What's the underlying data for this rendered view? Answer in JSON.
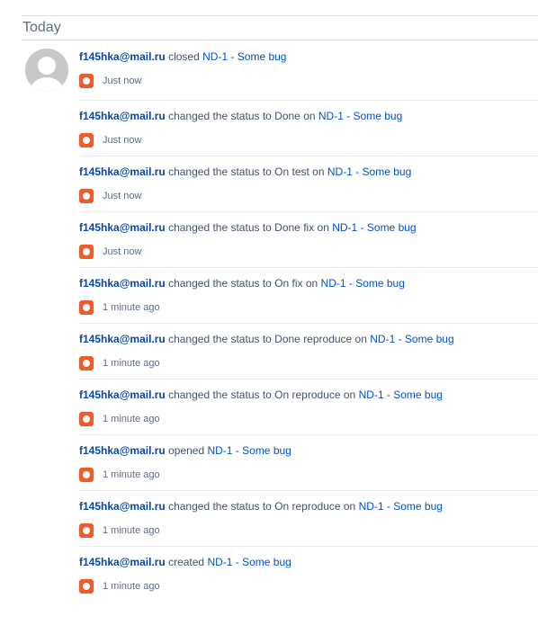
{
  "group": {
    "title": "Today"
  },
  "entries": [
    {
      "user": "f145hka@mail.ru",
      "action": " closed ",
      "issue": "ND-1 - Some bug",
      "time": "Just now"
    },
    {
      "user": "f145hka@mail.ru",
      "action": " changed the status to Done on ",
      "issue": "ND-1 - Some bug",
      "time": "Just now"
    },
    {
      "user": "f145hka@mail.ru",
      "action": " changed the status to On test on ",
      "issue": "ND-1 - Some bug",
      "time": "Just now"
    },
    {
      "user": "f145hka@mail.ru",
      "action": " changed the status to Done fix on ",
      "issue": "ND-1 - Some bug",
      "time": "Just now"
    },
    {
      "user": "f145hka@mail.ru",
      "action": " changed the status to On fix on ",
      "issue": "ND-1 - Some bug",
      "time": "1 minute ago"
    },
    {
      "user": "f145hka@mail.ru",
      "action": " changed the status to Done reproduce on ",
      "issue": "ND-1 - Some bug",
      "time": "1 minute ago"
    },
    {
      "user": "f145hka@mail.ru",
      "action": " changed the status to On reproduce on ",
      "issue": "ND-1 - Some bug",
      "time": "1 minute ago"
    },
    {
      "user": "f145hka@mail.ru",
      "action": " opened ",
      "issue": "ND-1 - Some bug",
      "time": "1 minute ago"
    },
    {
      "user": "f145hka@mail.ru",
      "action": " changed the status to On reproduce on ",
      "issue": "ND-1 - Some bug",
      "time": "1 minute ago"
    },
    {
      "user": "f145hka@mail.ru",
      "action": " created ",
      "issue": "ND-1 - Some bug",
      "time": "1 minute ago"
    }
  ],
  "icons": {
    "avatar": "default-user-avatar",
    "app": "app-circle-icon"
  },
  "colors": {
    "user_link": "#0747a6",
    "issue_link": "#0052cc",
    "app_icon": "#f15a2b"
  }
}
